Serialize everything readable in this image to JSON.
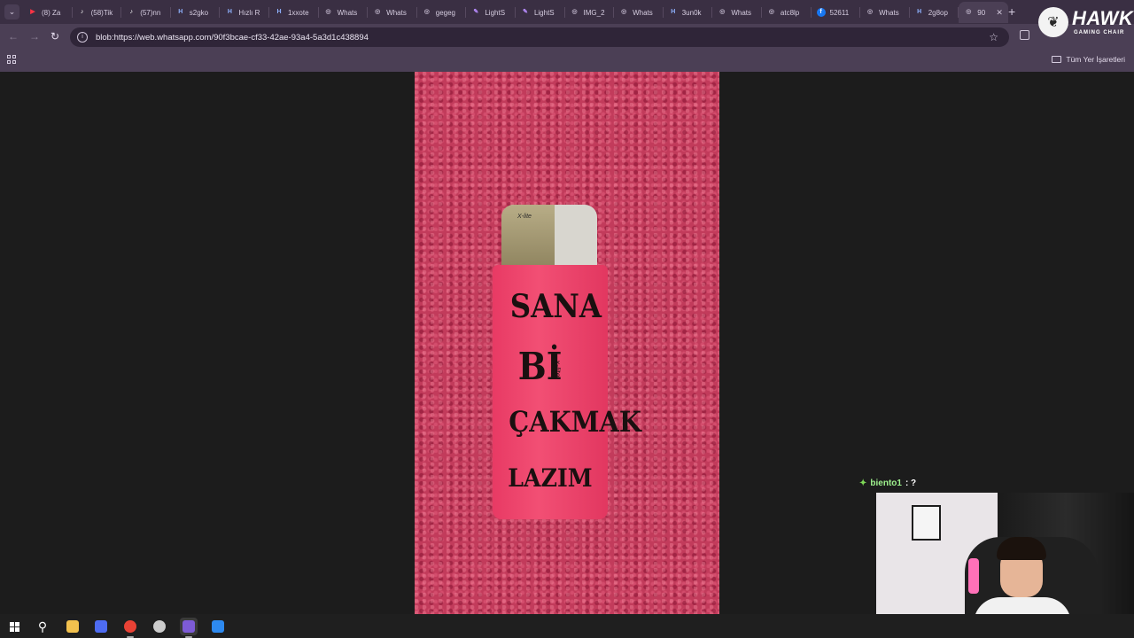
{
  "tabs": [
    {
      "label": "(8) Za",
      "icon": "youtube-icon",
      "color": "#ff3344"
    },
    {
      "label": "(58)Tik",
      "icon": "tiktok-icon",
      "color": "#ffffff"
    },
    {
      "label": "(57)nn",
      "icon": "tiktok-icon",
      "color": "#ffffff"
    },
    {
      "label": "s2gko",
      "icon": "h-site-icon",
      "color": "#8fb2ff"
    },
    {
      "label": "Hızlı R",
      "icon": "h-site-icon",
      "color": "#8fb2ff"
    },
    {
      "label": "1xxote",
      "icon": "h-site-icon",
      "color": "#8fb2ff"
    },
    {
      "label": "Whats",
      "icon": "globe-icon",
      "color": "#bdb3c8"
    },
    {
      "label": "Whats",
      "icon": "globe-icon",
      "color": "#bdb3c8"
    },
    {
      "label": "gegeg",
      "icon": "globe-icon",
      "color": "#bdb3c8"
    },
    {
      "label": "LightS",
      "icon": "lightshot-icon",
      "color": "#b88cff"
    },
    {
      "label": "LightS",
      "icon": "lightshot-icon",
      "color": "#b88cff"
    },
    {
      "label": "IMG_2",
      "icon": "globe-icon",
      "color": "#bdb3c8"
    },
    {
      "label": "Whats",
      "icon": "globe-icon",
      "color": "#bdb3c8"
    },
    {
      "label": "3un0k",
      "icon": "h-site-icon",
      "color": "#8fb2ff"
    },
    {
      "label": "Whats",
      "icon": "globe-icon",
      "color": "#bdb3c8"
    },
    {
      "label": "atc8lp",
      "icon": "globe-icon",
      "color": "#bdb3c8"
    },
    {
      "label": "52611",
      "icon": "facebook-icon",
      "color": "#1877f2"
    },
    {
      "label": "Whats",
      "icon": "globe-icon",
      "color": "#bdb3c8"
    },
    {
      "label": "2g8op",
      "icon": "h-site-icon",
      "color": "#8fb2ff"
    },
    {
      "label": "90",
      "icon": "globe-icon",
      "color": "#bdb3c8",
      "active": true
    }
  ],
  "toolbar": {
    "back_icon": "←",
    "forward_icon": "→",
    "reload_icon": "↻",
    "url": "blob:https://web.whatsapp.com/90f3bcae-cf33-42ae-93a4-5a3d1c438894",
    "star_icon": "☆",
    "site_info_icon": "i"
  },
  "bookmarks": {
    "all_bookmarks_label": "Tüm Yer İşaretleri"
  },
  "photo": {
    "brand_top": "X-lite",
    "brand_side": "x-lite",
    "line1": "SANA",
    "line2": "Bİ",
    "line3": "ÇAKMAK",
    "line4": "LAZIM"
  },
  "chat": {
    "diamond": "✦",
    "username": "biento1",
    "message": ": ?"
  },
  "watermark": {
    "title": "HAWK",
    "subtitle": "GAMING CHAIR",
    "logo_glyph": "❦"
  },
  "taskbar": {
    "search_glyph": "⚲",
    "apps": [
      {
        "name": "file-explorer-icon",
        "color": "#f2c14e"
      },
      {
        "name": "cortana-icon",
        "color": "#4e6cf2"
      },
      {
        "name": "chrome-icon",
        "color": "#e94235"
      },
      {
        "name": "obs-icon",
        "color": "#cccccc"
      },
      {
        "name": "chrome-profile-icon",
        "color": "#7d5bd6"
      },
      {
        "name": "app-icon",
        "color": "#2d89ef"
      }
    ]
  },
  "colors": {
    "tab_strip": "#3a2f43",
    "toolbar": "#4b3f55",
    "page_bg": "#1c1c1c"
  }
}
